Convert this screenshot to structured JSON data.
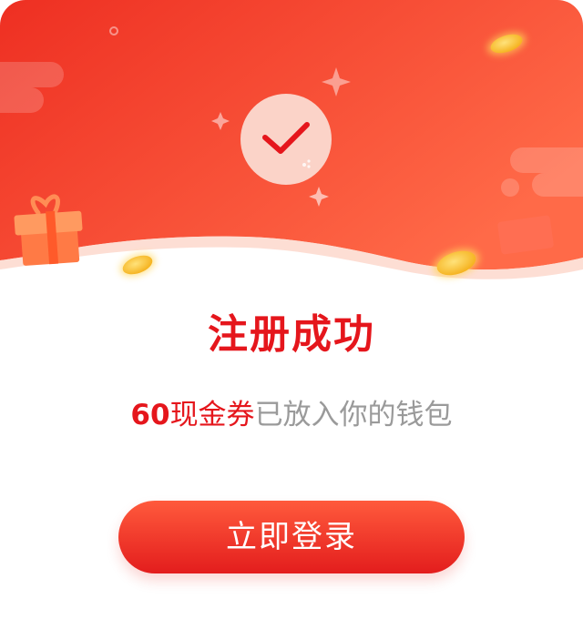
{
  "dialog": {
    "title": "注册成功",
    "message": {
      "amount": "60",
      "coupon": "现金券",
      "rest": "已放入你的钱包"
    },
    "login_button": "立即登录",
    "icons": {
      "badge": "check-icon",
      "gift": "gift-icon",
      "coin": "coin-icon",
      "sparkle": "sparkle-icon"
    },
    "colors": {
      "accent": "#e5161c",
      "header_gradient_start": "#f03c2a",
      "header_gradient_end": "#ff6a4a",
      "muted_text": "#9a9a9a"
    }
  }
}
